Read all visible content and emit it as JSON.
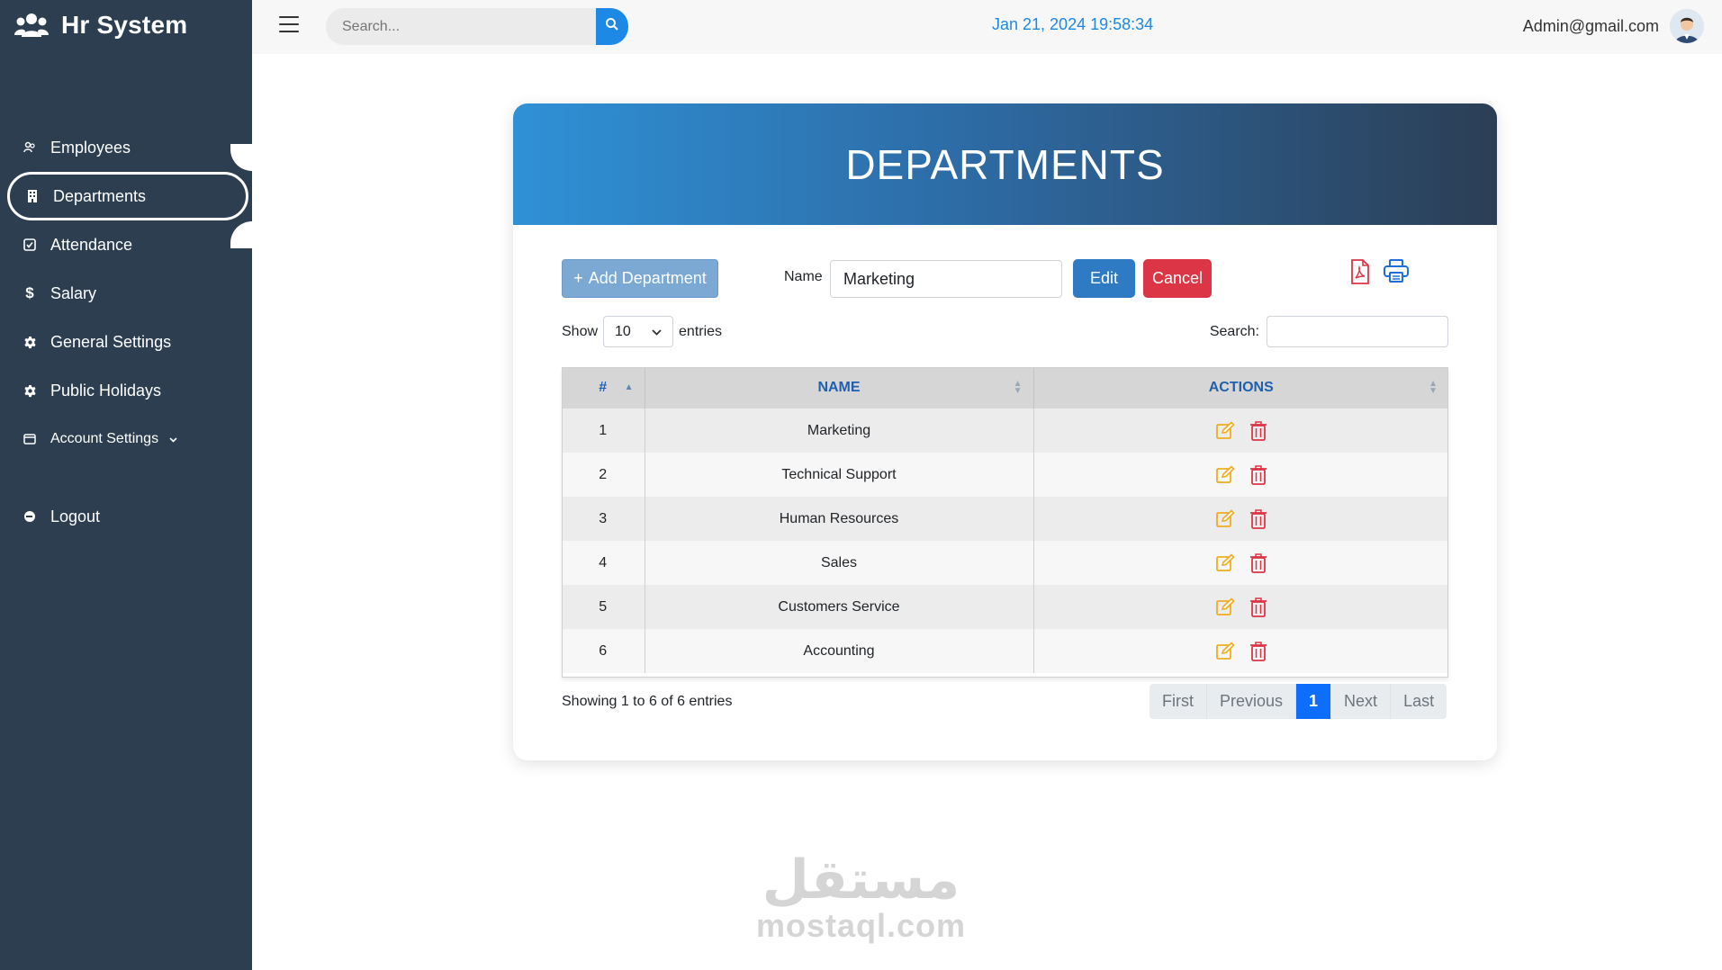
{
  "app": {
    "title": "Hr System"
  },
  "sidebar": {
    "items": [
      {
        "label": "Employees",
        "icon": "users-icon"
      },
      {
        "label": "Departments",
        "icon": "building-icon"
      },
      {
        "label": "Attendance",
        "icon": "check-square-icon"
      },
      {
        "label": "Salary",
        "icon": "dollar-icon"
      },
      {
        "label": "General Settings",
        "icon": "gear-icon"
      },
      {
        "label": "Public Holidays",
        "icon": "gear-icon"
      },
      {
        "label": "Account Settings",
        "icon": "id-card-icon"
      }
    ],
    "logout": {
      "label": "Logout",
      "icon": "logout-icon"
    }
  },
  "topbar": {
    "search_placeholder": "Search...",
    "datetime": "Jan 21, 2024 19:58:34",
    "user_email": "Admin@gmail.com"
  },
  "page": {
    "title": "DEPARTMENTS"
  },
  "form": {
    "add_label": "Add Department",
    "name_label": "Name",
    "name_value": "Marketing",
    "edit_label": "Edit",
    "cancel_label": "Cancel"
  },
  "table_controls": {
    "show_label": "Show",
    "page_size": "10",
    "entries_label": "entries",
    "search_label": "Search:"
  },
  "table": {
    "columns": [
      "#",
      "NAME",
      "ACTIONS"
    ],
    "rows": [
      {
        "id": "1",
        "name": "Marketing"
      },
      {
        "id": "2",
        "name": "Technical Support"
      },
      {
        "id": "3",
        "name": "Human Resources"
      },
      {
        "id": "4",
        "name": "Sales"
      },
      {
        "id": "5",
        "name": "Customers Service"
      },
      {
        "id": "6",
        "name": "Accounting"
      }
    ]
  },
  "footer": {
    "info": "Showing 1 to 6 of 6 entries",
    "pager": {
      "first": "First",
      "previous": "Previous",
      "current": "1",
      "next": "Next",
      "last": "Last"
    }
  },
  "watermark": {
    "arabic": "مستقل",
    "latin": "mostaql.com"
  },
  "colors": {
    "sidebar_bg": "#2c3e50",
    "accent": "#1e88e5",
    "danger": "#dc3545",
    "warning": "#f0ad1e"
  }
}
